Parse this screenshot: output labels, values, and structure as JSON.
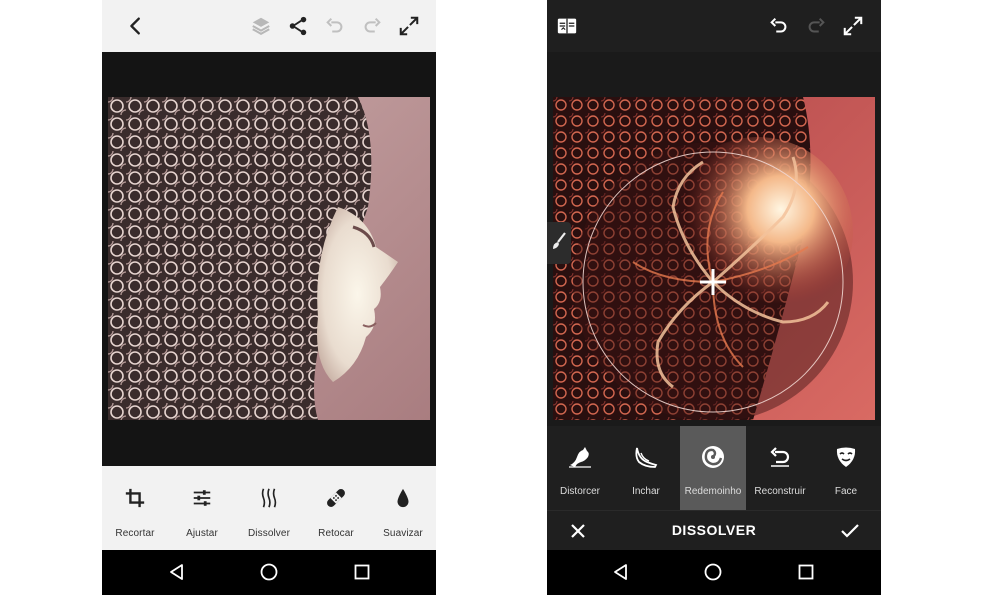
{
  "left_screen": {
    "toolbar": {
      "tools": [
        {
          "label": "Recortar",
          "icon": "crop-icon"
        },
        {
          "label": "Ajustar",
          "icon": "adjust-sliders-icon"
        },
        {
          "label": "Dissolver",
          "icon": "liquify-waves-icon"
        },
        {
          "label": "Retocar",
          "icon": "bandage-icon"
        },
        {
          "label": "Suavizar",
          "icon": "drop-icon"
        }
      ]
    }
  },
  "right_screen": {
    "tools": [
      {
        "label": "Distorcer",
        "icon": "distort-hand-icon"
      },
      {
        "label": "Inchar",
        "icon": "bloat-icon"
      },
      {
        "label": "Redemoinho",
        "icon": "swirl-icon",
        "active": true
      },
      {
        "label": "Reconstruir",
        "icon": "reconstruct-undo-icon"
      },
      {
        "label": "Face",
        "icon": "face-mask-icon"
      }
    ],
    "footer": {
      "title": "DISSOLVER"
    }
  },
  "colors": {
    "light_bar": "#f2f2f2",
    "dark_bar": "#1f1f1f",
    "active_tool": "#5a5a5a",
    "disabled_icon": "#bdbdbd"
  }
}
